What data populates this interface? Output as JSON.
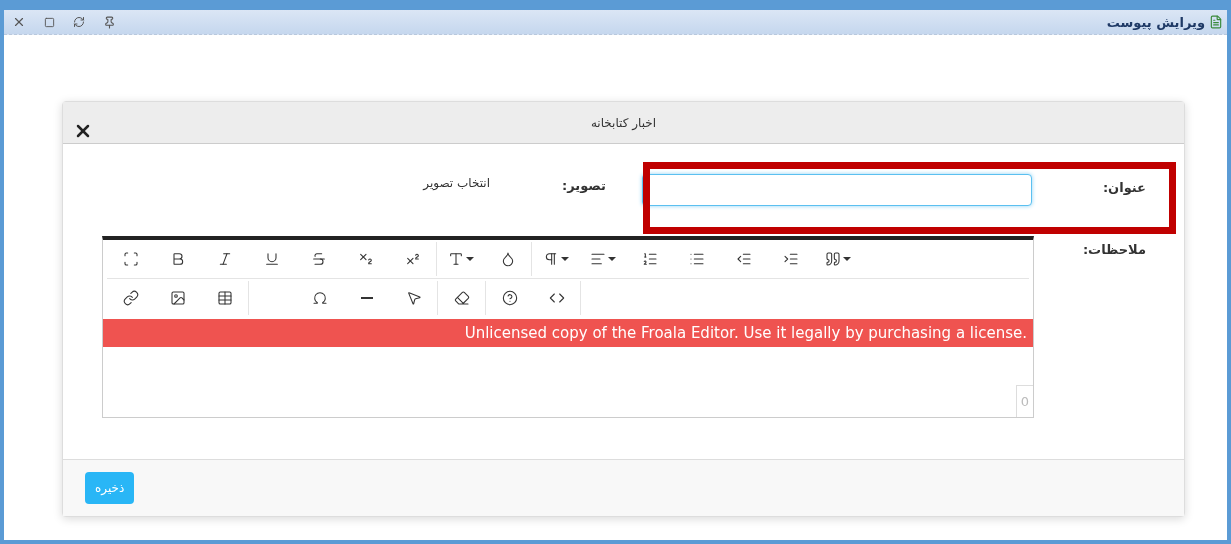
{
  "window": {
    "title": "ویرایش پیوست"
  },
  "dialog": {
    "title": "اخبار کتابخانه"
  },
  "title_field": {
    "label": "عنوان:",
    "focused": true,
    "highlighted": true
  },
  "image": {
    "label": "تصویر:",
    "link": "انتخاب تصویر"
  },
  "notes": {
    "label": "ملاحظات:",
    "banner": "Unlicensed copy of the Froala Editor. Use it legally by purchasing a license.",
    "counter": "0"
  },
  "buttons": [
    {
      "label": "ذخیره"
    }
  ]
}
